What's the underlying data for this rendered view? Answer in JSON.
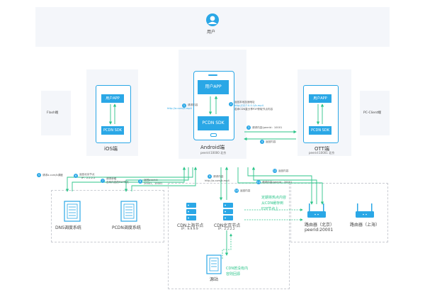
{
  "user": {
    "label": "用户"
  },
  "flash": {
    "label": "Flash端"
  },
  "pc_client": {
    "label": "PC-Client端"
  },
  "ios": {
    "title": "iOS端",
    "app": "用户APP",
    "sdk": "PCDN SDK"
  },
  "android": {
    "title": "Android端",
    "sub": "peerid:10000 北京",
    "app": "用户APP",
    "sdk": "PCDN SDK"
  },
  "ott": {
    "title": "OTT端",
    "sub": "peerid:10001 北京",
    "app": "用户APP",
    "sdk": "PCDN SDK"
  },
  "steps": {
    "s1": {
      "num": "1",
      "text": "请求内容",
      "url": "http://a.com/b.mp4"
    },
    "s2": {
      "num": "2",
      "text1": "返回本地加速地址",
      "url": "http://127.0.0.1/b.mp4",
      "text2": "若命CDN直分享P2P获取节点内容"
    },
    "s3": {
      "num": "3",
      "text": "请求内容(peerid：10001"
    },
    "s4": {
      "num": "4",
      "text": "返回内容"
    },
    "s5": {
      "num": "5",
      "text": "请求a.com/b调度"
    },
    "s6": {
      "num": "6",
      "text": "返回北京节点",
      "ip": "IP：2.2.2.2"
    },
    "s7": {
      "num": "7",
      "text1": "请求获取",
      "text2": "含有内容的P2P节点"
    },
    "s8": {
      "num": "8",
      "text1": "返回peerid：",
      "text2": "20001，10001"
    },
    "s9": {
      "num": "9",
      "text": "请求内容",
      "url": "http://a.com/b.mp4"
    },
    "s10": {
      "num": "10",
      "text": "返回内容"
    },
    "s11": {
      "num": "11",
      "text": "请求内容(peerid：20001"
    },
    "s12": {
      "num": "12",
      "text": "返回内容"
    }
  },
  "dns": {
    "label": "DNS调度系统"
  },
  "pcdn": {
    "label": "PCDN调度系统"
  },
  "cdn_sh": {
    "label": "CDN上海节点",
    "ip": "IP：9.9.9.9"
  },
  "cdn_bj": {
    "label": "CDN北京节点",
    "ip": "IP：2.2.2.2"
  },
  "hot_note": {
    "l1": "定期将热点内容",
    "l2": "从CDN缓存到",
    "l3": "P2P节点上"
  },
  "router_bj": {
    "label": "路由器（北京）",
    "peer": "peerid:20001"
  },
  "router_sh": {
    "label": "路由器（上海）"
  },
  "origin": {
    "label": "源站"
  },
  "origin_note": {
    "l1": "CDN若没有内",
    "l2": "容则回源"
  },
  "colors": {
    "accent": "#2aa7e6",
    "arrow": "#2cc58a",
    "panel": "#f4f6fa"
  }
}
